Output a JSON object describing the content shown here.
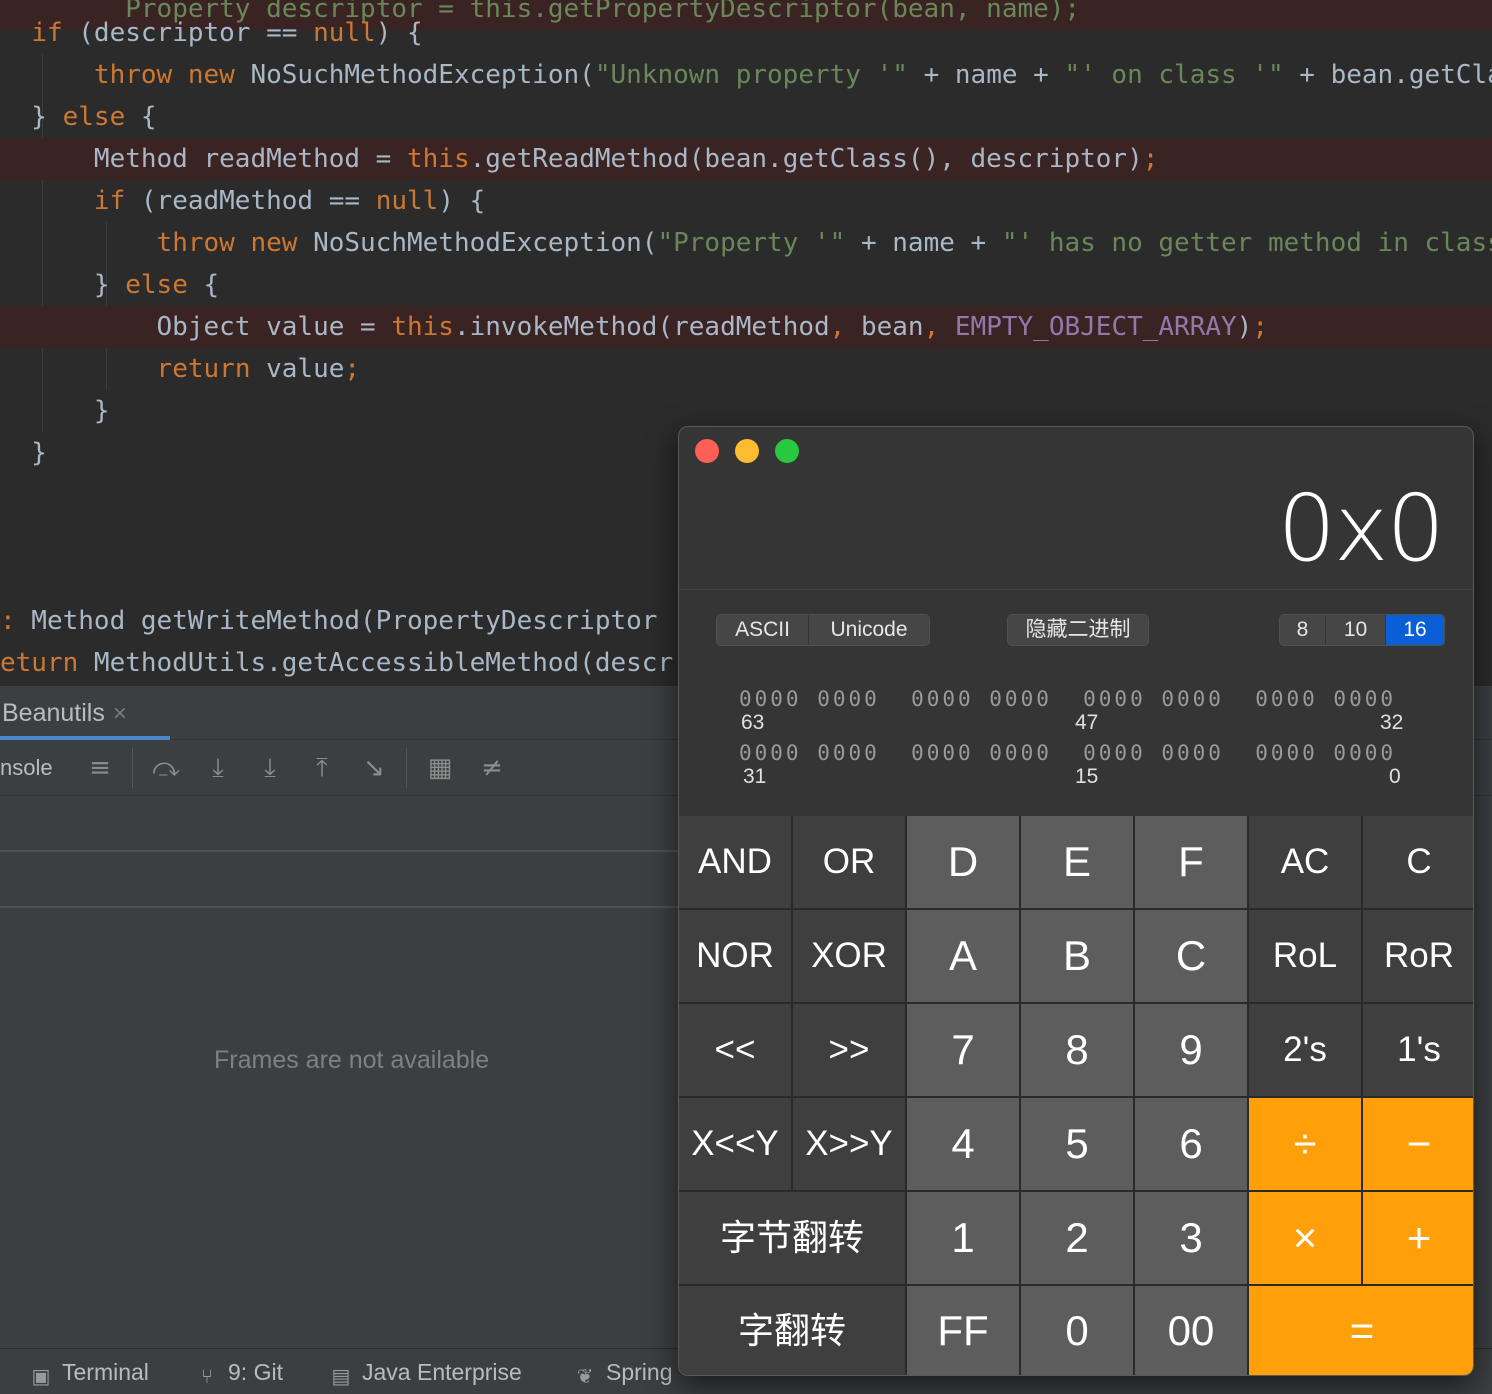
{
  "editor": {
    "lines": [
      {
        "id": "line-0",
        "html": "        <span class='str'>Property descriptor = this.getPropertyDescriptor(bean, name);</span>",
        "bp": true
      },
      {
        "id": "line-1",
        "html": "  <span class='kw'>if</span> (descriptor == <span class='kw'>null</span>) {",
        "bp": false
      },
      {
        "id": "line-2",
        "html": "      <span class='kw'>throw new</span> NoSuchMethodException(<span class='str'>\"Unknown property '\"</span> + name + <span class='str'>\"' on class '\"</span> + bean.getClass() + <span class='str'>\"'\"</span>);",
        "bp": false
      },
      {
        "id": "line-3",
        "html": "  } <span class='kw'>else</span> {",
        "bp": false
      },
      {
        "id": "line-4",
        "html": "      Method readMethod = <span class='kw'>this</span>.getReadMethod(bean.getClass(), descriptor)<span class='kw'>;</span>",
        "bp": true
      },
      {
        "id": "line-5",
        "html": "      <span class='kw'>if</span> (readMethod == <span class='kw'>null</span>) {",
        "bp": false
      },
      {
        "id": "line-6",
        "html": "          <span class='kw'>throw new</span> NoSuchMethodException(<span class='str'>\"Property '\"</span> + name + <span class='str'>\"' has no getter method in class\"</span>);",
        "bp": false
      },
      {
        "id": "line-7",
        "html": "      } <span class='kw'>else</span> {",
        "bp": false
      },
      {
        "id": "line-8",
        "html": "          Object value = <span class='kw'>this</span>.invokeMethod(readMethod<span class='kw'>,</span> bean<span class='kw'>,</span> <span class='fld'>EMPTY_OBJECT_ARRAY</span>)<span class='kw'>;</span>",
        "bp": true
      },
      {
        "id": "line-9",
        "html": "          <span class='kw'>return</span> value<span class='kw'>;</span>",
        "bp": false
      },
      {
        "id": "line-10",
        "html": "      }",
        "bp": false
      },
      {
        "id": "line-11",
        "html": "  }",
        "bp": false
      },
      {
        "id": "line-12",
        "html": "",
        "bp": false
      },
      {
        "id": "line-13",
        "html": "",
        "bp": false
      },
      {
        "id": "line-14",
        "html": "<span class='kw'>:</span> Method getWriteMethod(PropertyDescriptor",
        "bp": false
      },
      {
        "id": "line-15",
        "html": "<span class='kw'>eturn</span> MethodUtils.getAccessibleMethod(descr",
        "bp": false
      }
    ]
  },
  "debug": {
    "tab_label": "Beanutils",
    "tab_close": "×",
    "console_label": "nsole",
    "toolbar_icons": [
      "menu-icon",
      "step-over-icon",
      "step-into-icon",
      "force-step-into-icon",
      "step-out-icon",
      "run-to-cursor-icon",
      "evaluate-expression-icon",
      "trace-icon"
    ],
    "frames_empty": "Frames are not available"
  },
  "statusbar": {
    "terminal": "Terminal",
    "git": "9: Git",
    "java_enterprise": "Java Enterprise",
    "spring": "Spring"
  },
  "calculator": {
    "display": "0x0",
    "mode_left": [
      "ASCII",
      "Unicode"
    ],
    "hide_binary": "隐藏二进制",
    "base_options": [
      "8",
      "10",
      "16"
    ],
    "active_base": "16",
    "bits_row1": "0000 0000  0000 0000  0000 0000  0000 0000",
    "bits_row2": "0000 0000  0000 0000  0000 0000  0000 0000",
    "bit_labels_row1": [
      "63",
      "47",
      "32"
    ],
    "bit_labels_row2": [
      "31",
      "15",
      "0"
    ],
    "keys": [
      [
        "AND",
        "OR",
        "D",
        "E",
        "F",
        "AC",
        "C"
      ],
      [
        "NOR",
        "XOR",
        "A",
        "B",
        "C",
        "RoL",
        "RoR"
      ],
      [
        "<<",
        ">>",
        "7",
        "8",
        "9",
        "2's",
        "1's"
      ],
      [
        "X<<Y",
        "X>>Y",
        "4",
        "5",
        "6",
        "÷",
        "−"
      ],
      [
        "字节翻转",
        "1",
        "2",
        "3",
        "×",
        "+"
      ],
      [
        "字翻转",
        "FF",
        "0",
        "00",
        "="
      ]
    ],
    "colors": {
      "function": "#3f3f3f",
      "digit": "#5d5d5d",
      "operator": "#ff9f0a",
      "active_base": "#0a5fd6"
    }
  }
}
